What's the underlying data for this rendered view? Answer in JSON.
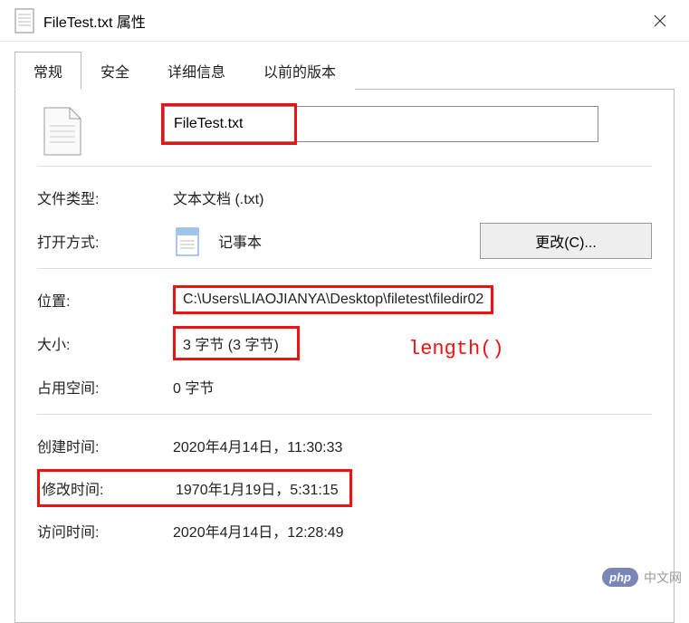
{
  "titlebar": {
    "title": "FileTest.txt 属性"
  },
  "tabs": [
    {
      "label": "常规",
      "active": true
    },
    {
      "label": "安全",
      "active": false
    },
    {
      "label": "详细信息",
      "active": false
    },
    {
      "label": "以前的版本",
      "active": false
    }
  ],
  "filename": {
    "value": "FileTest.txt"
  },
  "filetype": {
    "label": "文件类型:",
    "value": "文本文档 (.txt)"
  },
  "opens_with": {
    "label": "打开方式:",
    "app": "记事本",
    "change_btn": "更改(C)..."
  },
  "location": {
    "label": "位置:",
    "value": "C:\\Users\\LIAOJIANYA\\Desktop\\filetest\\filedir02"
  },
  "size": {
    "label": "大小:",
    "value": "3 字节 (3 字节)"
  },
  "size_on_disk": {
    "label": "占用空间:",
    "value": "0 字节"
  },
  "created": {
    "label": "创建时间:",
    "value": "2020年4月14日，11:30:33"
  },
  "modified": {
    "label": "修改时间:",
    "value": "1970年1月19日，5:31:15"
  },
  "accessed": {
    "label": "访问时间:",
    "value": "2020年4月14日，12:28:49"
  },
  "annotation": "length()",
  "watermark": {
    "badge": "php",
    "text": "中文网"
  }
}
